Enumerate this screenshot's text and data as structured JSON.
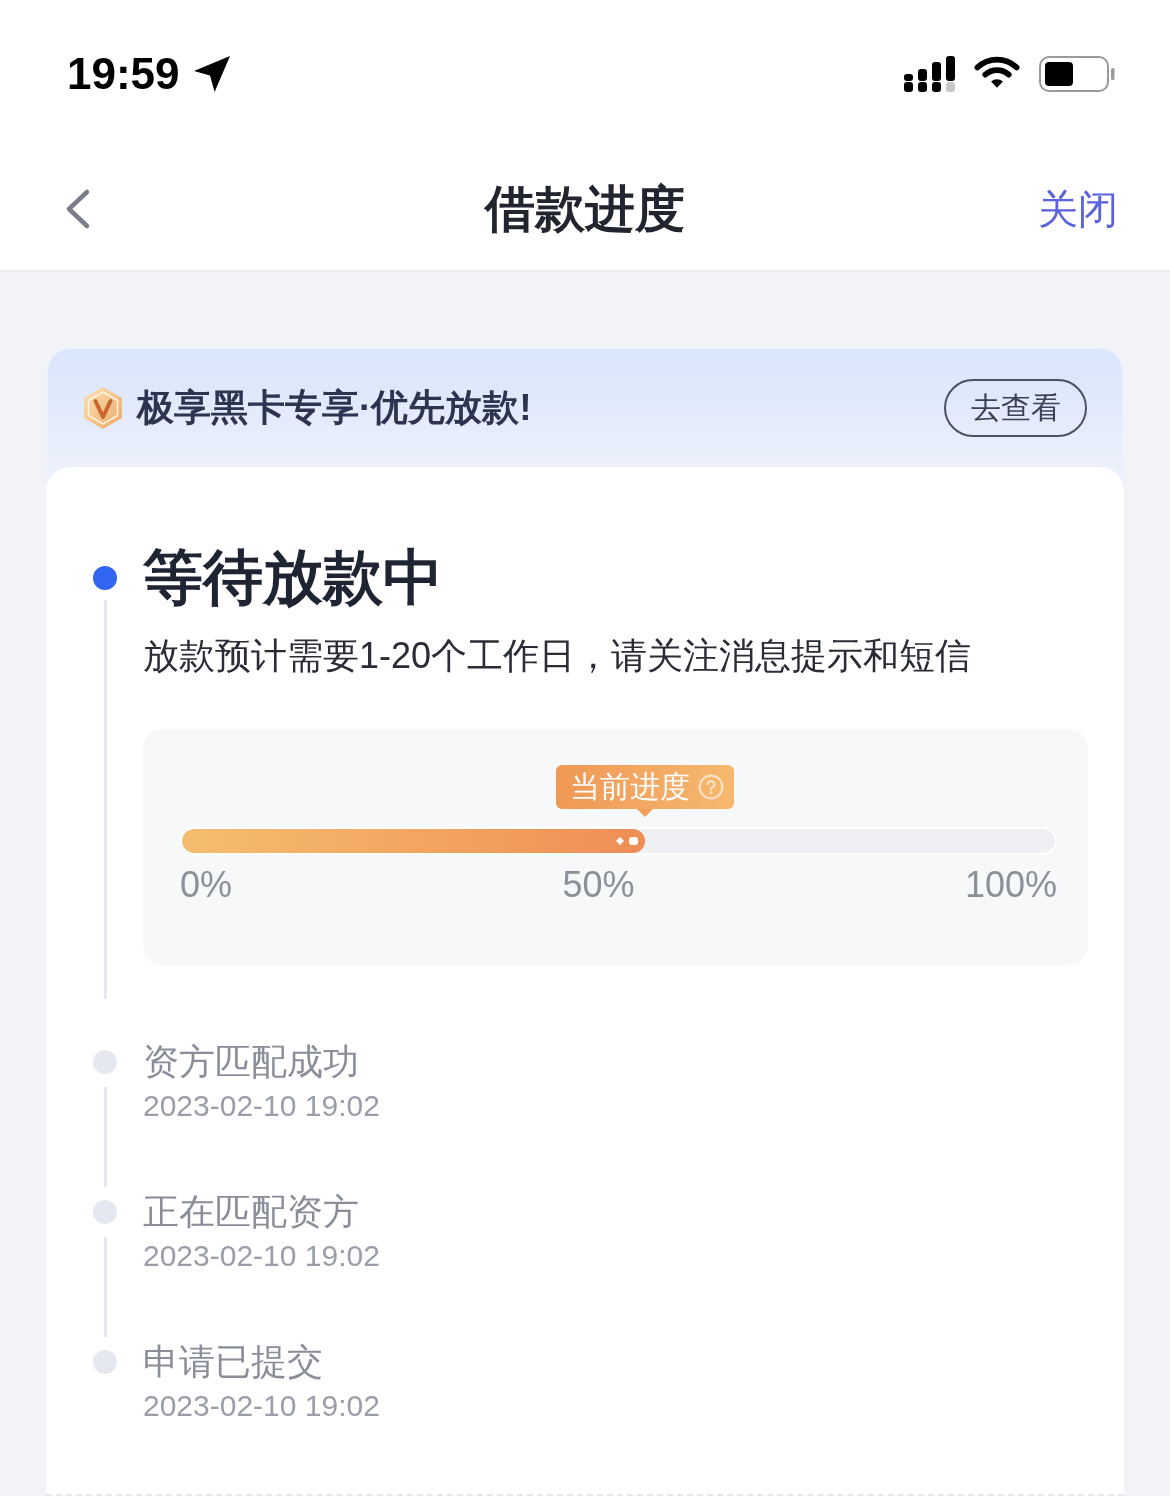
{
  "status_bar": {
    "time": "19:59"
  },
  "nav": {
    "title": "借款进度",
    "close": "关闭"
  },
  "banner": {
    "text": "极享黑卡专享·优先放款!",
    "button": "去查看"
  },
  "steps": [
    {
      "title": "等待放款中",
      "current": true,
      "description": "放款预计需要1-20个工作日，请关注消息提示和短信",
      "progress": {
        "tooltip": "当前进度",
        "level": 0.53,
        "labels": [
          "0%",
          "50%",
          "100%"
        ]
      }
    },
    {
      "title": "资方匹配成功",
      "current": false,
      "time": "2023-02-10 19:02"
    },
    {
      "title": "正在匹配资方",
      "current": false,
      "time": "2023-02-10 19:02"
    },
    {
      "title": "申请已提交",
      "current": false,
      "time": "2023-02-10 19:02"
    }
  ]
}
